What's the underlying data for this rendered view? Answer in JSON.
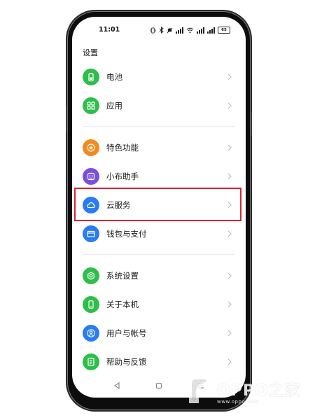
{
  "status_bar": {
    "time": "11:01",
    "battery": "65"
  },
  "page_title": "设置",
  "settings": [
    {
      "label": "电池",
      "icon": "battery-icon",
      "color": "#2fbd4b"
    },
    {
      "label": "应用",
      "icon": "apps-grid-icon",
      "color": "#2fbd4b"
    },
    {
      "label": "特色功能",
      "icon": "star-icon",
      "color": "#f28a1f"
    },
    {
      "label": "小布助手",
      "icon": "assistant-icon",
      "color": "#7a4fe0"
    },
    {
      "label": "云服务",
      "icon": "cloud-icon",
      "color": "#2a7cf0"
    },
    {
      "label": "钱包与支付",
      "icon": "wallet-icon",
      "color": "#2a7cf0"
    },
    {
      "label": "系统设置",
      "icon": "gear-icon",
      "color": "#2fbd4b"
    },
    {
      "label": "关于本机",
      "icon": "phone-icon",
      "color": "#2fbd4b"
    },
    {
      "label": "用户与帐号",
      "icon": "user-icon",
      "color": "#2a7cf0"
    },
    {
      "label": "帮助与反馈",
      "icon": "help-icon",
      "color": "#2fbd4b"
    }
  ],
  "highlighted_item": "云服务",
  "highlight_color": "#d9232f",
  "watermark": {
    "brand": "OPPO之家",
    "url": "www.oppo.com"
  }
}
